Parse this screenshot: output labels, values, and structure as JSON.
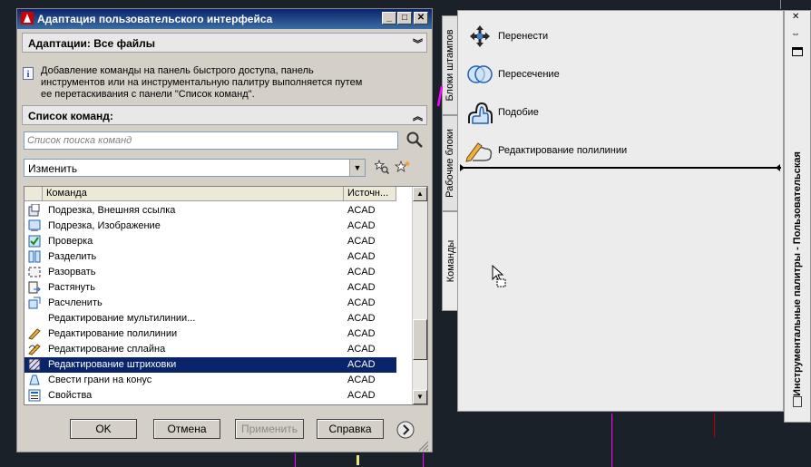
{
  "colors": {
    "background": "#1b2128",
    "titlebar": "#0a246a",
    "selection": "#0a246a",
    "accent_magenta": "#ff00ff",
    "accent_red": "#c00000"
  },
  "dialog": {
    "title": "Адаптация пользовательского интерфейса",
    "window_buttons": [
      "_",
      "□",
      "✕"
    ],
    "customizations_header": "Адаптации: Все файлы",
    "info_text": "Добавление команды на панель быстрого доступа, панель инструментов или на инструментальную палитру выполняется путем ее перетаскивания с панели \"Список команд\".",
    "command_list_header": "Список команд:",
    "search_placeholder": "Список поиска команд",
    "filter_value": "Изменить",
    "columns": {
      "command": "Команда",
      "source": "Источн..."
    },
    "rows": [
      {
        "name": "Подрезка, Внешняя ссылка",
        "source": "ACAD",
        "icon": "clip-xref-icon"
      },
      {
        "name": "Подрезка, Изображение",
        "source": "ACAD",
        "icon": "clip-image-icon"
      },
      {
        "name": "Проверка",
        "source": "ACAD",
        "icon": "audit-icon"
      },
      {
        "name": "Разделить",
        "source": "ACAD",
        "icon": "divide-icon"
      },
      {
        "name": "Разорвать",
        "source": "ACAD",
        "icon": "break-icon"
      },
      {
        "name": "Растянуть",
        "source": "ACAD",
        "icon": "stretch-icon"
      },
      {
        "name": "Расчленить",
        "source": "ACAD",
        "icon": "explode-icon"
      },
      {
        "name": "Редактирование мультилинии...",
        "source": "ACAD",
        "icon": ""
      },
      {
        "name": "Редактирование полилинии",
        "source": "ACAD",
        "icon": "pedit-icon"
      },
      {
        "name": "Редактирование сплайна",
        "source": "ACAD",
        "icon": "spline-edit-icon"
      },
      {
        "name": "Редактирование штриховки",
        "source": "ACAD",
        "icon": "hatch-edit-icon",
        "selected": true
      },
      {
        "name": "Свести грани на конус",
        "source": "ACAD",
        "icon": "taper-icon"
      },
      {
        "name": "Свойства",
        "source": "ACAD",
        "icon": "properties-icon"
      }
    ],
    "buttons": {
      "ok": "OK",
      "cancel": "Отмена",
      "apply": "Применить",
      "help": "Справка"
    }
  },
  "palette": {
    "tabs": [
      "Блоки штампов",
      "Рабочие блоки",
      "Команды"
    ],
    "tools": [
      "Перенести",
      "Пересечение",
      "Подобие",
      "Редактирование полилинии"
    ],
    "strip_title": "Инструментальные палитры - Пользовательская"
  }
}
